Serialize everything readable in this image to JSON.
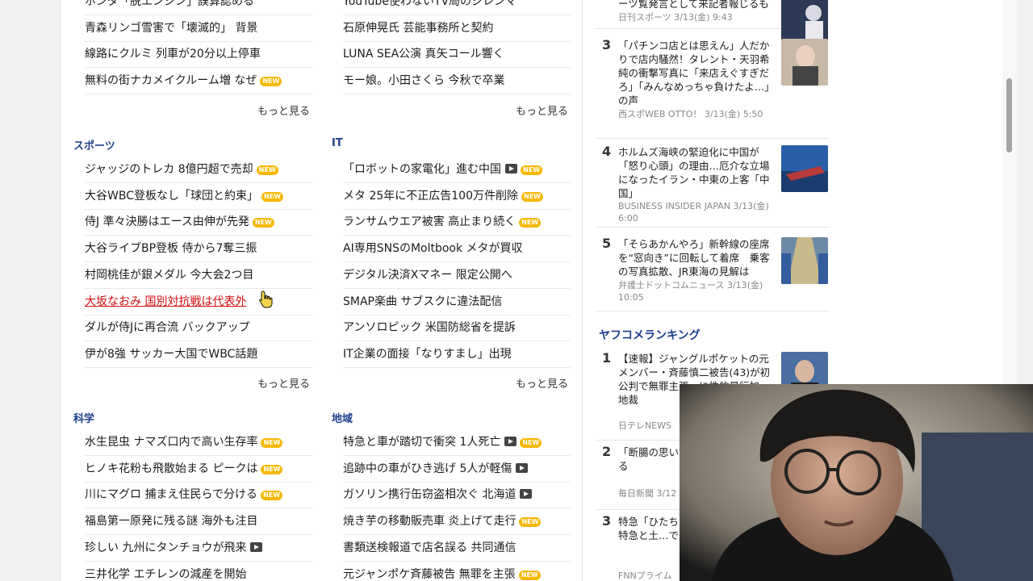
{
  "entertainment_col1": [
    {
      "text": "ホンダ「脱エンジン」誤算認める",
      "new": false,
      "video": false
    },
    {
      "text": "青森リンゴ雪害で「壊滅的」 背景",
      "new": false,
      "video": false
    },
    {
      "text": "線路にクルミ 列車が20分以上停車",
      "new": false,
      "video": false
    },
    {
      "text": "無料の街ナカメイクルーム増 なぜ",
      "new": true,
      "video": false
    }
  ],
  "entertainment_col2": [
    {
      "text": "YouTube使わないTV局のジレンマ",
      "new": false,
      "video": false
    },
    {
      "text": "石原伸晃氏 芸能事務所と契約",
      "new": false,
      "video": false
    },
    {
      "text": "LUNA SEA公演 真矢コール響く",
      "new": false,
      "video": false
    },
    {
      "text": "モー娘。小田さくら 今秋で卒業",
      "new": false,
      "video": false
    }
  ],
  "more_label": "もっと見る",
  "new_label": "NEW",
  "sports": {
    "title": "スポーツ",
    "items": [
      {
        "text": "ジャッジのトレカ 8億円超で売却",
        "new": true,
        "video": false,
        "hover": false
      },
      {
        "text": "大谷WBC登板なし「球団と約束」",
        "new": true,
        "video": false,
        "hover": false
      },
      {
        "text": "侍J 準々決勝はエース由伸が先発",
        "new": true,
        "video": false,
        "hover": false
      },
      {
        "text": "大谷ライブBP登板 侍から7奪三振",
        "new": false,
        "video": false,
        "hover": false
      },
      {
        "text": "村岡桃佳が銀メダル 今大会2つ目",
        "new": false,
        "video": false,
        "hover": false
      },
      {
        "text": "大坂なおみ 国別対抗戦は代表外",
        "new": false,
        "video": false,
        "hover": true
      },
      {
        "text": "ダルが侍Jに再合流 バックアップ",
        "new": false,
        "video": false,
        "hover": false
      },
      {
        "text": "伊が8強 サッカー大国でWBC話題",
        "new": false,
        "video": false,
        "hover": false
      }
    ]
  },
  "it": {
    "title": "IT",
    "items": [
      {
        "text": "「ロボットの家電化」進む中国",
        "new": true,
        "video": true
      },
      {
        "text": "メタ 25年に不正広告100万件削除",
        "new": true,
        "video": false
      },
      {
        "text": "ランサムウエア被害 高止まり続く",
        "new": true,
        "video": false
      },
      {
        "text": "AI専用SNSのMoltbook メタが買収",
        "new": false,
        "video": false
      },
      {
        "text": "デジタル決済Xマネー 限定公開へ",
        "new": false,
        "video": false
      },
      {
        "text": "SMAP楽曲 サブスクに違法配信",
        "new": false,
        "video": false
      },
      {
        "text": "アンソロピック 米国防総省を提訴",
        "new": false,
        "video": false
      },
      {
        "text": "IT企業の面接「なりすまし」出現",
        "new": false,
        "video": false
      }
    ]
  },
  "science": {
    "title": "科学",
    "items": [
      {
        "text": "水生昆虫 ナマズ口内で高い生存率",
        "new": true,
        "video": false
      },
      {
        "text": "ヒノキ花粉も飛散始まる ピークは",
        "new": true,
        "video": false
      },
      {
        "text": "川にマグロ 捕まえ住民らで分ける",
        "new": true,
        "video": false
      },
      {
        "text": "福島第一原発に残る謎 海外も注目",
        "new": false,
        "video": false
      },
      {
        "text": "珍しい 九州にタンチョウが飛来",
        "new": false,
        "video": true
      },
      {
        "text": "三井化学 エチレンの減産を開始",
        "new": false,
        "video": false
      }
    ]
  },
  "local": {
    "title": "地域",
    "items": [
      {
        "text": "特急と車が踏切で衝突 1人死亡",
        "new": true,
        "video": true
      },
      {
        "text": "追跡中の車がひき逃げ 5人が軽傷",
        "new": false,
        "video": true
      },
      {
        "text": "ガソリン携行缶窃盗相次ぐ 北海道",
        "new": false,
        "video": true
      },
      {
        "text": "焼き芋の移動販売車 炎上げて走行",
        "new": true,
        "video": false
      },
      {
        "text": "書類送検報道で店名誤る 共同通信",
        "new": false,
        "video": false
      },
      {
        "text": "元ジャンポケ斉藤被告 無罪を主張",
        "new": true,
        "video": false
      }
    ]
  },
  "access_ranking": [
    {
      "num": "",
      "text": "ーツ覧発言として来記者報じるも",
      "source": "日刊スポーツ 3/13(金) 9:43"
    },
    {
      "num": "3",
      "text": "「パチンコ店とは思えん」人だかりで店内騒然！タレント・天羽希純の衝撃写真に「来店えぐすぎだろ」「みんなめっちゃ負けたよ…」の声",
      "source": "西スポWEB OTTO！ 3/13(金) 5:50"
    },
    {
      "num": "4",
      "text": "ホルムズ海峡の緊迫化に中国が「怒り心頭」の理由…厄介な立場になったイラン・中東の上客「中国」",
      "source": "BUSINESS INSIDER JAPAN 3/13(金) 6:00"
    },
    {
      "num": "5",
      "text": "「そらあかんやろ」新幹線の座席を“窓向き”に回転して着席　乗客の写真拡散、JR東海の見解は",
      "source": "弁護士ドットコムニュース 3/13(金) 10:05"
    }
  ],
  "yafuko": {
    "title": "ヤフコメランキング",
    "items": [
      {
        "num": "1",
        "text": "【速報】ジャングルポケットの元メンバー・斉藤慎二被告(43)が初公判で無罪主張…に性的暴行加…地裁",
        "source": "日テレNEWS"
      },
      {
        "num": "2",
        "text": "「断腸の思い…長、「脱エン…める",
        "source": "毎日新聞 3/12"
      },
      {
        "num": "3",
        "text": "特急「ひたち…切で衝突1人…の特急と土…で運転見合わ",
        "source": "FNNプライム"
      }
    ]
  },
  "colors": {
    "link": "#1b1b1b",
    "hover": "#d20f0f",
    "heading": "#1d3f8c",
    "new_badge": "#f5b800"
  }
}
